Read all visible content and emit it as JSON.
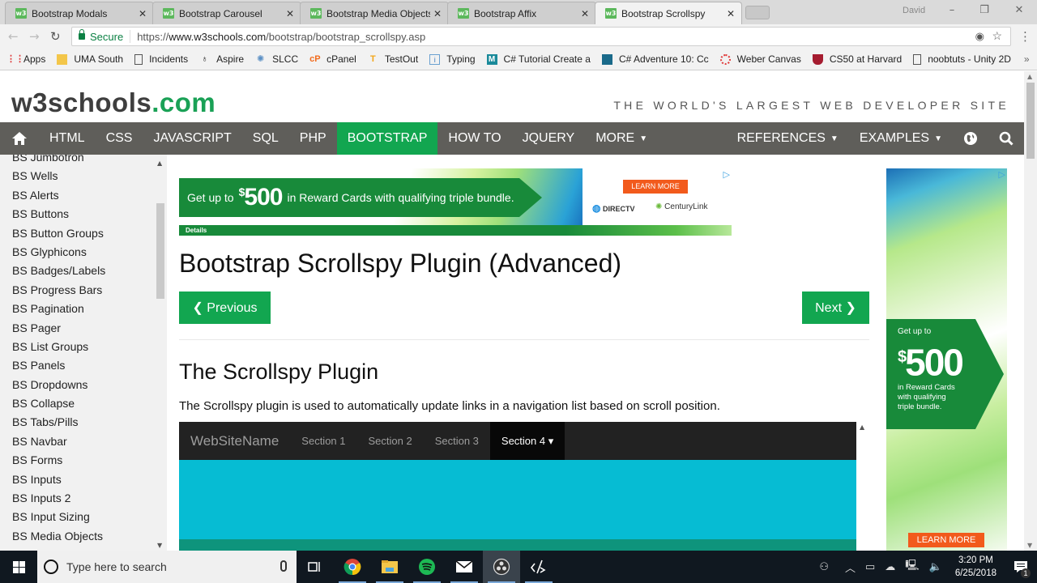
{
  "browser": {
    "tabs": [
      {
        "label": "Bootstrap Modals",
        "favicon": "w3-icon",
        "active": false
      },
      {
        "label": "Bootstrap Carousel",
        "favicon": "w3-icon",
        "active": false
      },
      {
        "label": "Bootstrap Media Objects",
        "favicon": "w3-icon",
        "active": false
      },
      {
        "label": "Bootstrap Affix",
        "favicon": "w3-icon",
        "active": false
      },
      {
        "label": "Bootstrap Scrollspy",
        "favicon": "w3-icon",
        "active": true
      }
    ],
    "favicon_text": "w3",
    "user_name": "David",
    "address": {
      "secure_label": "Secure",
      "url_scheme": "https://",
      "url_host": "www.w3schools.com",
      "url_path": "/bootstrap/bootstrap_scrollspy.asp"
    },
    "bookmarks": [
      {
        "label": "Apps",
        "icon": "apps-grid-icon"
      },
      {
        "label": "UMA South",
        "icon": "folder-icon"
      },
      {
        "label": "Incidents",
        "icon": "page-icon"
      },
      {
        "label": "Aspire",
        "icon": "aspire-icon"
      },
      {
        "label": "SLCC",
        "icon": "slcc-icon"
      },
      {
        "label": "cPanel",
        "icon": "cpanel-icon"
      },
      {
        "label": "TestOut",
        "icon": "testout-icon"
      },
      {
        "label": "Typing",
        "icon": "typing-icon"
      },
      {
        "label": "C# Tutorial Create a",
        "icon": "m-icon"
      },
      {
        "label": "C# Adventure 10: Cc",
        "icon": "adventure-icon"
      },
      {
        "label": "Weber Canvas",
        "icon": "canvas-icon"
      },
      {
        "label": "CS50 at Harvard",
        "icon": "harvard-icon"
      },
      {
        "label": "noobtuts - Unity 2D",
        "icon": "page-icon"
      }
    ],
    "bookmarks_overflow": "»"
  },
  "site": {
    "logo_main": "w3schools",
    "logo_suffix": ".com",
    "tagline": "THE WORLD'S LARGEST WEB DEVELOPER SITE",
    "nav": [
      {
        "label": "HTML"
      },
      {
        "label": "CSS"
      },
      {
        "label": "JAVASCRIPT"
      },
      {
        "label": "SQL"
      },
      {
        "label": "PHP"
      },
      {
        "label": "BOOTSTRAP",
        "active": true
      },
      {
        "label": "HOW TO"
      },
      {
        "label": "JQUERY"
      },
      {
        "label": "MORE",
        "dropdown": true
      }
    ],
    "nav_right": [
      {
        "label": "REFERENCES",
        "dropdown": true
      },
      {
        "label": "EXAMPLES",
        "dropdown": true
      }
    ],
    "caret": "▼",
    "accent_color": "#12a650",
    "nav_bg_color": "#5f5e5a"
  },
  "sidebar": {
    "items": [
      "BS Jumbotron",
      "BS Wells",
      "BS Alerts",
      "BS Buttons",
      "BS Button Groups",
      "BS Glyphicons",
      "BS Badges/Labels",
      "BS Progress Bars",
      "BS Pagination",
      "BS Pager",
      "BS List Groups",
      "BS Panels",
      "BS Dropdowns",
      "BS Collapse",
      "BS Tabs/Pills",
      "BS Navbar",
      "BS Forms",
      "BS Inputs",
      "BS Inputs 2",
      "BS Input Sizing",
      "BS Media Objects"
    ]
  },
  "ad_banner": {
    "lead": "Get up to",
    "currency": "$",
    "amount": "500",
    "rest": "in Reward Cards with qualifying triple bundle.",
    "cta": "LEARN MORE",
    "brand1": "DIRECTV",
    "brand2": "CenturyLink",
    "details": "Details",
    "adchoice": "▷"
  },
  "ad_side": {
    "lead": "Get up to",
    "currency": "$",
    "amount": "500",
    "rest": "in Reward Cards with qualifying triple bundle.",
    "cta": "LEARN MORE",
    "adchoice": "▷"
  },
  "main": {
    "title": "Bootstrap Scrollspy Plugin (Advanced)",
    "prev_label": "❮ Previous",
    "next_label": "Next ❯",
    "section_heading": "The Scrollspy Plugin",
    "description": "The Scrollspy plugin is used to automatically update links in a navigation list based on scroll position.",
    "demo": {
      "brand": "WebSiteName",
      "links": [
        {
          "label": "Section 1",
          "active": false
        },
        {
          "label": "Section 2",
          "active": false
        },
        {
          "label": "Section 3",
          "active": false
        },
        {
          "label": "Section 4 ▾",
          "active": true
        }
      ],
      "section_color": "#06bcd3",
      "next_section_color": "#0e947c"
    }
  },
  "taskbar": {
    "search_placeholder": "Type here to search",
    "apps": [
      "task-view-icon",
      "chrome-icon",
      "file-explorer-icon",
      "spotify-icon",
      "mail-icon",
      "obs-icon",
      "code-editor-icon"
    ],
    "time": "3:20 PM",
    "date": "6/25/2018",
    "notification_count": "1"
  }
}
